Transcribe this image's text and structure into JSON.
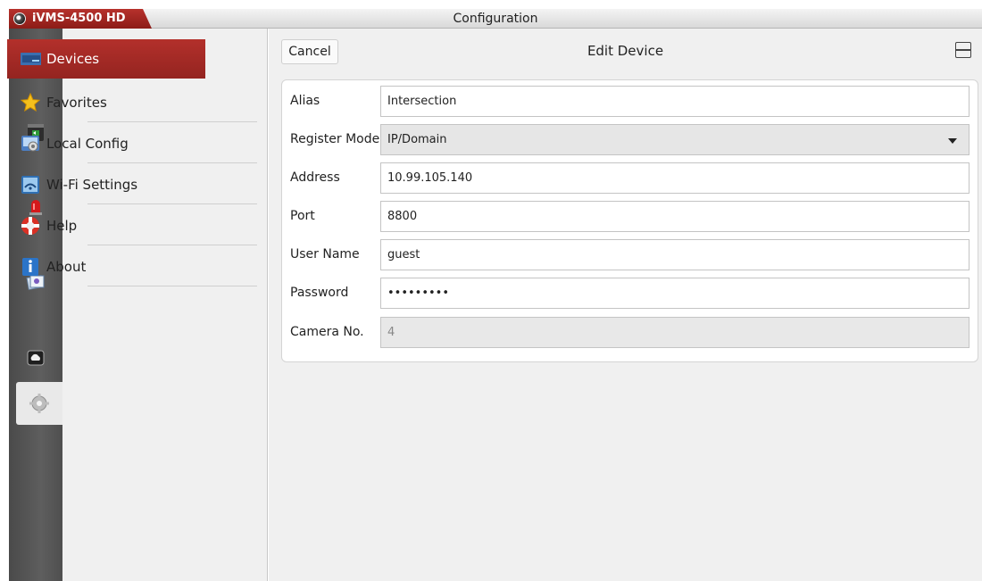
{
  "app": {
    "name": "iVMS-4500 HD",
    "window_title": "Configuration"
  },
  "rail": {
    "items": [
      {
        "icon": "live-view-icon"
      },
      {
        "icon": "playback-icon"
      },
      {
        "icon": "alarm-icon"
      },
      {
        "icon": "picture-video-icon"
      },
      {
        "icon": "cloud-icon"
      },
      {
        "icon": "configuration-gear-icon",
        "active": true
      }
    ]
  },
  "menu": {
    "items": [
      {
        "label": "Devices",
        "icon": "devices-icon",
        "active": true
      },
      {
        "label": "Favorites",
        "icon": "favorites-star-icon"
      },
      {
        "label": "Local Config",
        "icon": "local-config-icon"
      },
      {
        "label": "Wi-Fi Settings",
        "icon": "wifi-settings-icon"
      },
      {
        "label": "Help",
        "icon": "help-lifebuoy-icon"
      },
      {
        "label": "About",
        "icon": "about-info-icon"
      }
    ]
  },
  "topbar": {
    "cancel_label": "Cancel",
    "title": "Edit Device",
    "layout_icon": "layout-icon"
  },
  "form": {
    "alias": {
      "label": "Alias",
      "value": "Intersection"
    },
    "register_mode": {
      "label": "Register Mode",
      "value": "IP/Domain"
    },
    "address": {
      "label": "Address",
      "value": "10.99.105.140"
    },
    "port": {
      "label": "Port",
      "value": "8800"
    },
    "user_name": {
      "label": "User Name",
      "value": "guest"
    },
    "password": {
      "label": "Password",
      "value": "•••••••••"
    },
    "camera_no": {
      "label": "Camera No.",
      "value": "4"
    }
  },
  "colors": {
    "accent": "#a52a25",
    "rail_bg": "#555555",
    "panel_bg": "#f0f0f0"
  }
}
